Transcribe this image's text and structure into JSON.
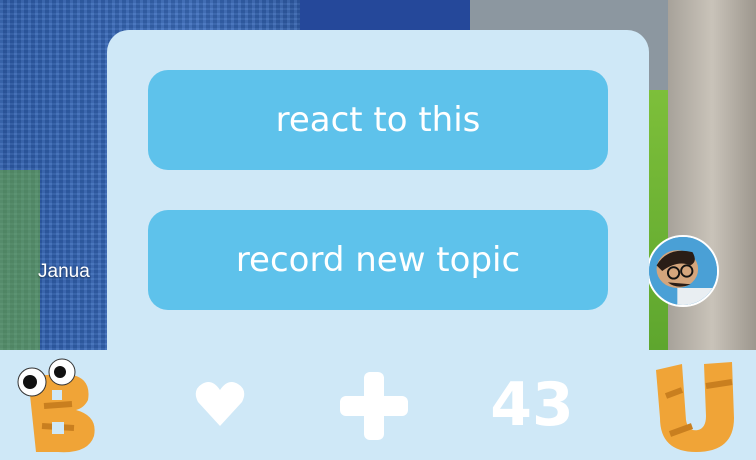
{
  "overlay": {
    "date_partial": "Janua"
  },
  "popup": {
    "react_label": "react to this",
    "record_label": "record new topic"
  },
  "bottom_bar": {
    "logo_icon": "b-monster-logo-icon",
    "heart_icon": "heart-icon",
    "plus_icon": "plus-icon",
    "count": "43",
    "profile_icon": "u-letter-icon"
  },
  "colors": {
    "popup_background": "#cfe8f7",
    "button_blue": "#5ec2eb",
    "logo_orange": "#f0a437"
  }
}
